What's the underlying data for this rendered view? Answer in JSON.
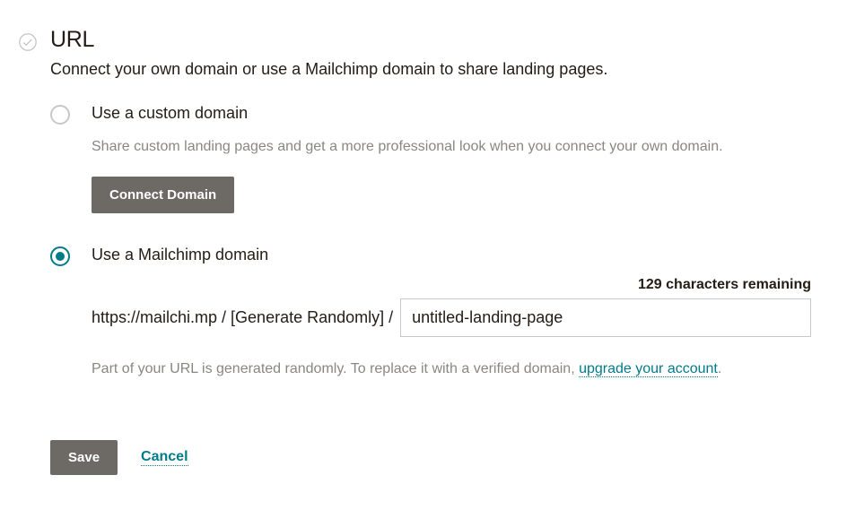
{
  "section": {
    "title": "URL",
    "description": "Connect your own domain or use a Mailchimp domain to share landing pages."
  },
  "custom_domain": {
    "label": "Use a custom domain",
    "help": "Share custom landing pages and get a more professional look when you connect your own domain.",
    "button": "Connect Domain"
  },
  "mailchimp_domain": {
    "label": "Use a Mailchimp domain",
    "chars_remaining": "129 characters remaining",
    "url_prefix": "https://mailchi.mp  /  [Generate Randomly]  /",
    "slug_value": "untitled-landing-page",
    "note_prefix": "Part of your URL is generated randomly. To replace it with a verified domain, ",
    "note_link": "upgrade your account",
    "note_suffix": "."
  },
  "actions": {
    "save": "Save",
    "cancel": "Cancel"
  }
}
